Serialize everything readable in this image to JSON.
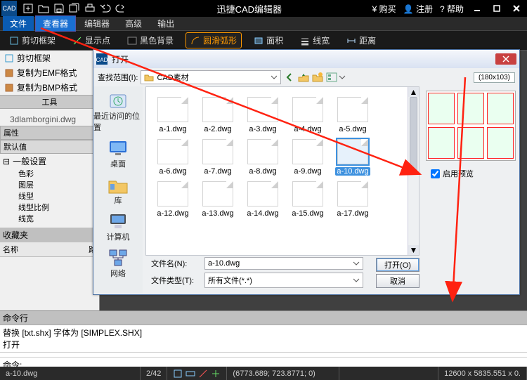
{
  "app": {
    "title": "迅捷CAD编辑器",
    "icon_label": "CAD",
    "right_links": {
      "buy": "购买",
      "register": "注册",
      "help": "帮助"
    }
  },
  "menubar": {
    "items": [
      "文件",
      "查看器",
      "编辑器",
      "高级",
      "输出"
    ],
    "active_index": 0,
    "hover_index": 1
  },
  "toolbar": {
    "items": [
      {
        "label": "剪切框架"
      },
      {
        "label": "显示点"
      },
      {
        "label": "黑色背景"
      },
      {
        "label": "圆滑弧形"
      },
      {
        "label": "面积"
      },
      {
        "label": "线宽"
      },
      {
        "label": "距离"
      }
    ],
    "highlight_index": 3
  },
  "left_sidebar": {
    "utility_items": [
      "剪切框架",
      "复制为EMF格式",
      "复制为BMP格式"
    ],
    "utility_group_label": "工具",
    "model_item": "3dlamborgini.dwg",
    "props_header": "属性",
    "default_header": "默认值",
    "general_header": "一般设置",
    "general_items": [
      "色彩",
      "图层",
      "线型",
      "线型比例",
      "线宽"
    ],
    "fav_header": "收藏夹",
    "fav_cols": {
      "name": "名称",
      "path": "路"
    }
  },
  "dialog": {
    "title": "打开",
    "look_in_label": "查找范围(I):",
    "look_in_value": "CAD素材",
    "dims_badge": "(180x103)",
    "places": [
      {
        "name": "最近访问的位置",
        "icon": "recent-icon"
      },
      {
        "name": "桌面",
        "icon": "desktop-icon"
      },
      {
        "name": "库",
        "icon": "library-icon"
      },
      {
        "name": "计算机",
        "icon": "computer-icon"
      },
      {
        "name": "网络",
        "icon": "network-icon"
      }
    ],
    "files": [
      "a-1.dwg",
      "a-2.dwg",
      "a-3.dwg",
      "a-4.dwg",
      "a-5.dwg",
      "a-6.dwg",
      "a-7.dwg",
      "a-8.dwg",
      "a-9.dwg",
      "a-10.dwg",
      "a-12.dwg",
      "a-13.dwg",
      "a-14.dwg",
      "a-15.dwg",
      "a-17.dwg"
    ],
    "selected_file_index": 9,
    "filename_label": "文件名(N):",
    "filename_value": "a-10.dwg",
    "filetype_label": "文件类型(T):",
    "filetype_value": "所有文件(*.*)",
    "open_btn": "打开(O)",
    "cancel_btn": "取消",
    "enable_preview_label": "启用预览",
    "enable_preview_checked": true
  },
  "command": {
    "header": "命令行",
    "log_line1": "替换 [txt.shx] 字体为 [SIMPLEX.SHX]",
    "log_line2": "打开",
    "prompt_label": "命令:"
  },
  "statusbar": {
    "file": "a-10.dwg",
    "counter": "2/42",
    "coords": "(6773.689; 723.8771; 0)",
    "extents": "12600 x 5835.551 x 0."
  }
}
